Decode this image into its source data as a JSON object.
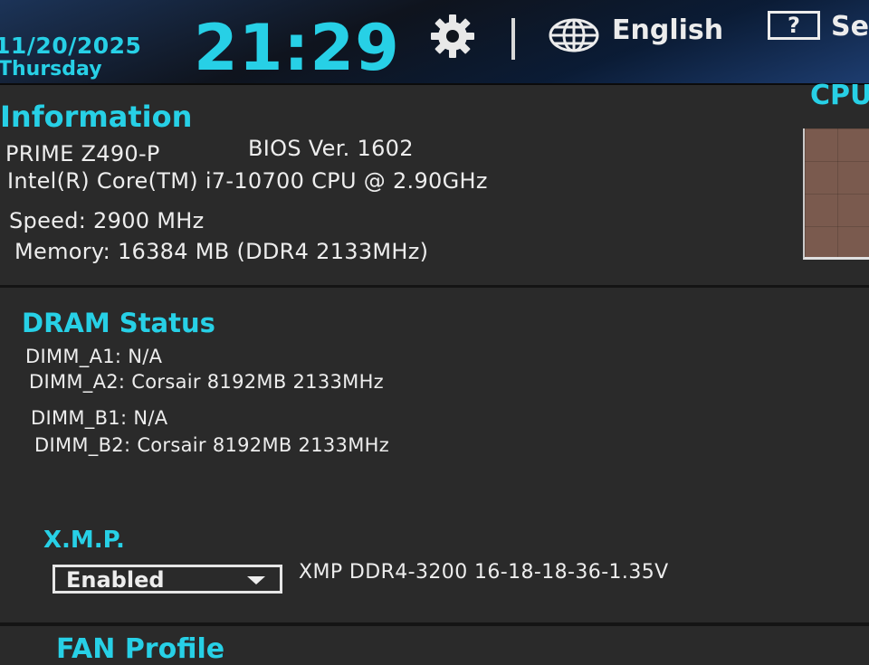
{
  "header": {
    "date": "11/20/2025",
    "day": "Thursday",
    "time": "21:29",
    "language": "English",
    "help_glyph": "?",
    "help_label": "Se",
    "accent_color": "#27d0e6"
  },
  "information": {
    "title": "Information",
    "board": "PRIME Z490-P",
    "bios": "BIOS Ver. 1602",
    "cpu": "Intel(R) Core(TM) i7-10700 CPU @ 2.90GHz",
    "speed": "Speed: 2900 MHz",
    "memory": "Memory: 16384 MB (DDR4 2133MHz)"
  },
  "cpu_panel": {
    "label": "CPU"
  },
  "dram": {
    "title": "DRAM Status",
    "slots": [
      "DIMM_A1: N/A",
      "DIMM_A2: Corsair 8192MB 2133MHz",
      "DIMM_B1: N/A",
      "DIMM_B2: Corsair 8192MB 2133MHz"
    ]
  },
  "xmp": {
    "title": "X.M.P.",
    "selected": "Enabled",
    "description": "XMP DDR4-3200 16-18-18-36-1.35V"
  },
  "fan": {
    "title": "FAN Profile"
  },
  "icons": {
    "settings": "gear-icon",
    "language": "globe-icon",
    "help": "help-icon",
    "dropdown": "chevron-down-icon"
  }
}
